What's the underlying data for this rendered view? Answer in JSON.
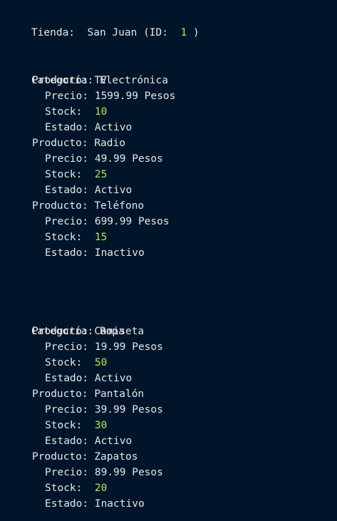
{
  "store": {
    "label": "Tienda:",
    "name": "San Juan",
    "id_prefix": "(ID:",
    "id": "1",
    "id_suffix": ")"
  },
  "labels": {
    "category": "Categoría:",
    "product": "Producto:",
    "price": "Precio:",
    "stock": "Stock:",
    "status": "Estado:"
  },
  "categories": [
    {
      "name": "Electrónica",
      "products": [
        {
          "name": "TV",
          "price": "1599.99 Pesos",
          "stock": "10",
          "status": "Activo"
        },
        {
          "name": "Radio",
          "price": "49.99 Pesos",
          "stock": "25",
          "status": "Activo"
        },
        {
          "name": "Teléfono",
          "price": "699.99 Pesos",
          "stock": "15",
          "status": "Inactivo"
        }
      ]
    },
    {
      "name": "Ropa",
      "products": [
        {
          "name": "Camiseta",
          "price": "19.99 Pesos",
          "stock": "50",
          "status": "Activo"
        },
        {
          "name": "Pantalón",
          "price": "39.99 Pesos",
          "stock": "30",
          "status": "Activo"
        },
        {
          "name": "Zapatos",
          "price": "89.99 Pesos",
          "stock": "20",
          "status": "Inactivo"
        }
      ]
    }
  ],
  "colors": {
    "background": "#001529",
    "text": "#e6e6e6",
    "number": "#b5e853"
  }
}
